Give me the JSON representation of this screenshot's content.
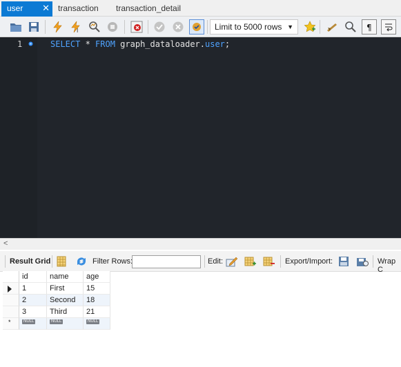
{
  "tabs": [
    {
      "label": "user",
      "close": "✕"
    },
    {
      "label": "transaction"
    },
    {
      "label": "transaction_detail"
    }
  ],
  "toolbar": {
    "limit_select": {
      "value": "Limit to 5000 rows"
    },
    "icons": [
      "open-folder-icon",
      "save-icon",
      "execute-icon",
      "execute-current-icon",
      "explain-icon",
      "stop-icon",
      "toggle-error-icon",
      "commit-icon",
      "rollback-icon",
      "autocommit-icon",
      "bookmark-icon",
      "beautify-icon",
      "find-icon",
      "invisible-chars-icon",
      "wrap-icon"
    ]
  },
  "editor": {
    "line_number": "1",
    "code": {
      "kw_select": "SELECT",
      "star": " * ",
      "kw_from": "FROM",
      "schema": " graph_dataloader.",
      "table": "user",
      "semi": ";"
    }
  },
  "scroll": {
    "left_arrow": "<"
  },
  "result_toolbar": {
    "result_grid_label": "Result Grid",
    "filter_rows_label": "Filter Rows:",
    "filter_value": "",
    "edit_label": "Edit:",
    "export_import_label": "Export/Import:",
    "wrap_label": "Wrap C"
  },
  "grid": {
    "columns": [
      "id",
      "name",
      "age"
    ],
    "rows": [
      {
        "id": "1",
        "name": "First",
        "age": "15"
      },
      {
        "id": "2",
        "name": "Second",
        "age": "18"
      },
      {
        "id": "3",
        "name": "Third",
        "age": "21"
      }
    ],
    "new_row": {
      "marker": "*",
      "id": "NULL",
      "name": "NULL",
      "age": "NULL"
    }
  },
  "colors": {
    "tab_active": "#0c7ad4",
    "editor_bg": "#21252b",
    "keyword": "#4fa3ff"
  }
}
